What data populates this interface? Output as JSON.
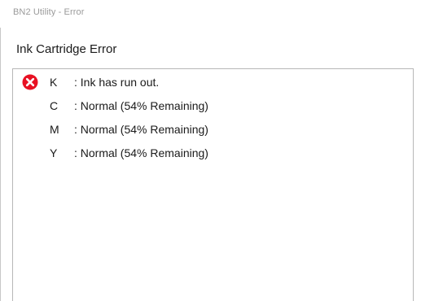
{
  "window": {
    "title": "BN2 Utility - Error"
  },
  "heading": "Ink Cartridge Error",
  "cartridges": [
    {
      "letter": "K",
      "status": ": Ink has run out.",
      "icon": "error-icon",
      "color": "#e81123"
    },
    {
      "letter": "C",
      "status": ": Normal (54% Remaining)",
      "icon": "",
      "color": ""
    },
    {
      "letter": "M",
      "status": ": Normal (54% Remaining)",
      "icon": "",
      "color": ""
    },
    {
      "letter": "Y",
      "status": ": Normal (54% Remaining)",
      "icon": "",
      "color": ""
    }
  ]
}
